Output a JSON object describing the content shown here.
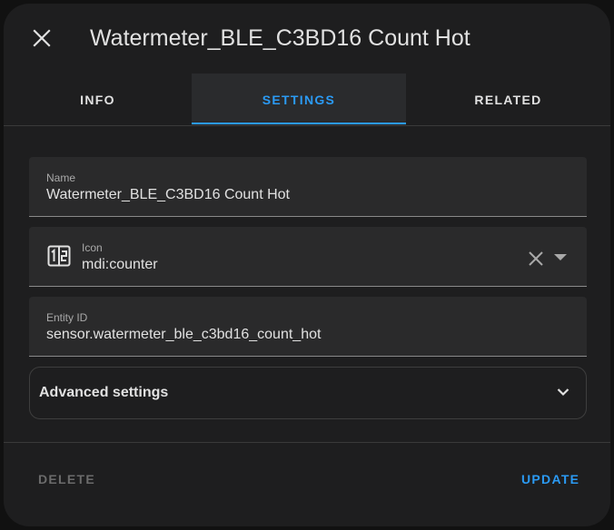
{
  "dialog": {
    "title": "Watermeter_BLE_C3BD16 Count Hot",
    "close_icon": "close-icon"
  },
  "tabs": [
    {
      "label": "INFO",
      "active": false
    },
    {
      "label": "SETTINGS",
      "active": true
    },
    {
      "label": "RELATED",
      "active": false
    }
  ],
  "fields": {
    "name": {
      "label": "Name",
      "value": "Watermeter_BLE_C3BD16 Count Hot"
    },
    "icon": {
      "label": "Icon",
      "value": "mdi:counter",
      "prefix_icon": "counter-icon"
    },
    "entity_id": {
      "label": "Entity ID",
      "value": "sensor.watermeter_ble_c3bd16_count_hot"
    }
  },
  "advanced": {
    "label": "Advanced settings"
  },
  "actions": {
    "delete_label": "DELETE",
    "update_label": "UPDATE"
  },
  "colors": {
    "accent": "#2b9af3",
    "surface": "#1e1e1f",
    "field_bg": "#2a2a2b",
    "text": "#e1e1e1",
    "disabled": "#6b6b6b"
  }
}
